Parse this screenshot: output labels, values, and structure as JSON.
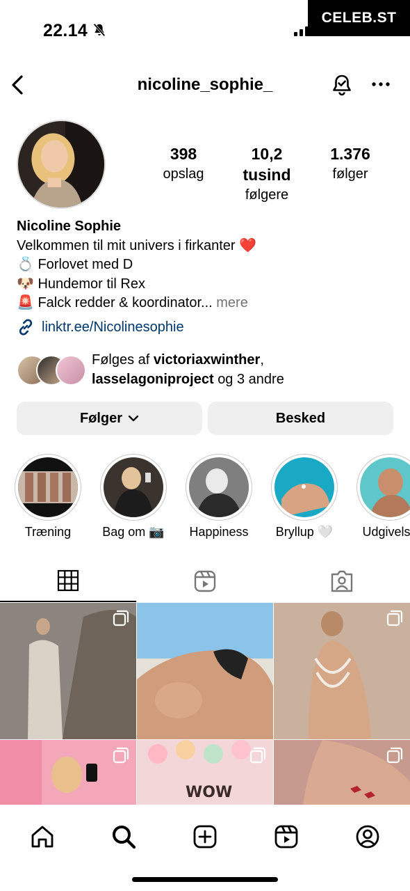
{
  "status_bar": {
    "time": "22.14",
    "watermark": "CELEB.ST"
  },
  "header": {
    "username": "nicoline_sophie_"
  },
  "stats": {
    "posts_count": "398",
    "posts_label": "opslag",
    "followers_count": "10,2 tusind",
    "followers_label": "følgere",
    "following_count": "1.376",
    "following_label": "følger"
  },
  "bio": {
    "name": "Nicoline Sophie",
    "line1": "Velkommen til mit univers i firkanter ❤️",
    "line2": "💍 Forlovet med D",
    "line3": "🐶 Hundemor til Rex",
    "line4": "🚨 Falck redder & koordinator...",
    "more": "mere",
    "link": "linktr.ee/Nicolinesophie"
  },
  "mutual": {
    "prefix": "Følges af",
    "user1": "victoriaxwinther",
    "comma": ",",
    "user2": "lasselagoniproject",
    "suffix": "og 3 andre"
  },
  "buttons": {
    "follow": "Følger",
    "message": "Besked"
  },
  "highlights": [
    {
      "label": "Træning"
    },
    {
      "label": "Bag om 📷"
    },
    {
      "label": "Happiness"
    },
    {
      "label": "Bryllup 🤍"
    },
    {
      "label": "Udgivelse"
    }
  ],
  "colors": {
    "link": "#00376b",
    "button_bg": "#efefef",
    "muted": "#737373",
    "ring": "#c7c7c7"
  },
  "icons": [
    "back-icon",
    "notification-bell-icon",
    "more-icon",
    "grid-icon",
    "reels-icon",
    "tagged-icon",
    "home-icon",
    "search-icon",
    "create-icon",
    "reels-nav-icon",
    "profile-icon",
    "carousel-icon"
  ]
}
